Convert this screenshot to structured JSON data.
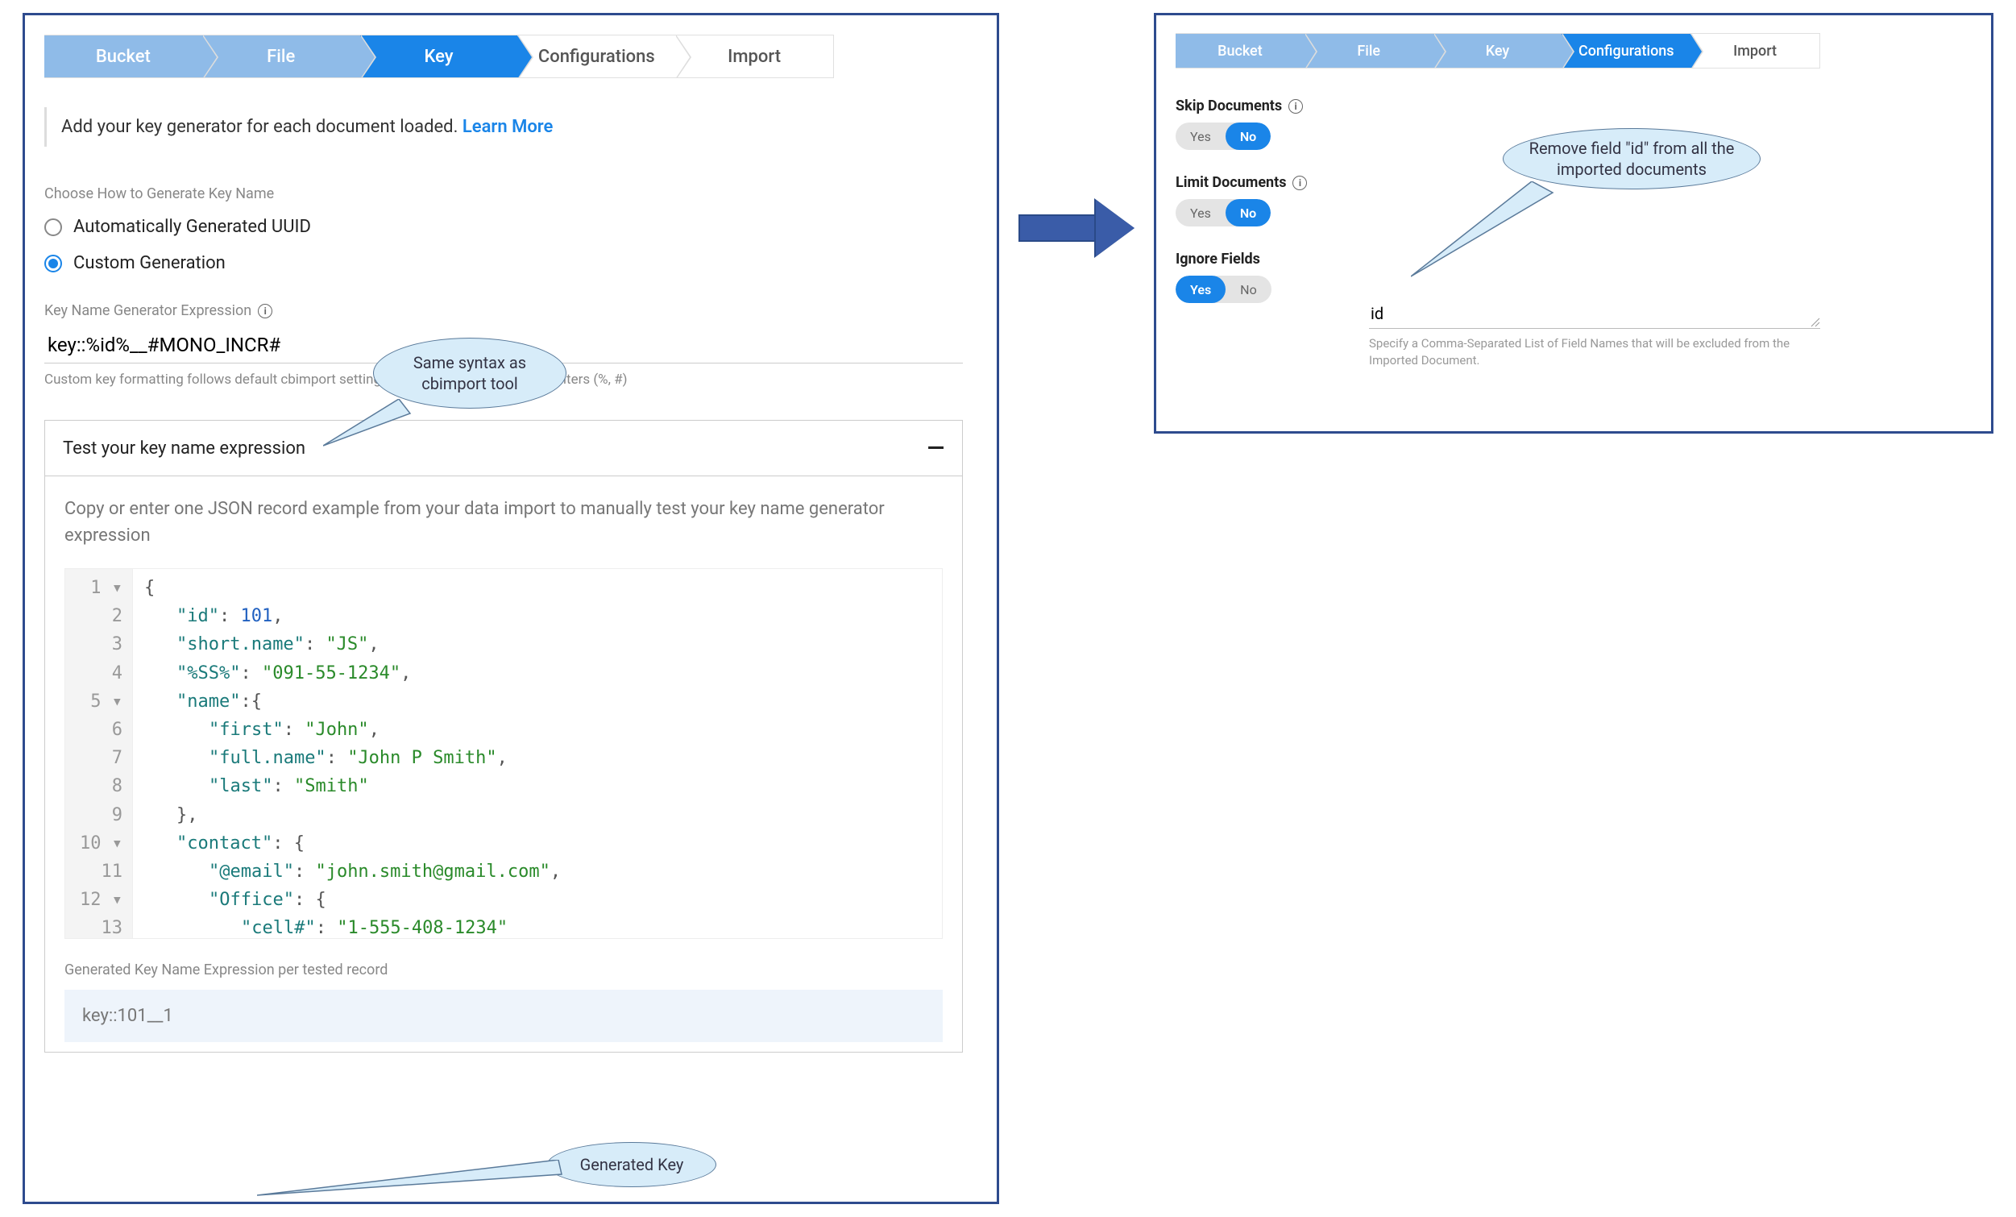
{
  "left": {
    "steps": [
      "Bucket",
      "File",
      "Key",
      "Configurations",
      "Import"
    ],
    "active_step_index": 2,
    "intro_text": "Add your key generator for each document loaded.",
    "intro_link": "Learn More",
    "choose_label": "Choose How to Generate Key Name",
    "radio_uuid": "Automatically Generated UUID",
    "radio_custom": "Custom Generation",
    "expr_label": "Key Name Generator Expression",
    "expr_value": "key::%id%__#MONO_INCR#",
    "expr_hint": "Custom key formatting follows default cbimport settings for field and generator delimiters (%, #)",
    "test_header": "Test your key name expression",
    "test_desc": "Copy or enter one JSON record example from your data import to manually test your key name generator expression",
    "code_gutter": [
      "1 ▾",
      "2",
      "3",
      "4",
      "5 ▾",
      "6",
      "7",
      "8",
      "9",
      "10 ▾",
      "11",
      "12 ▾",
      "13"
    ],
    "code_lines": [
      {
        "indent": 0,
        "tokens": [
          {
            "t": "punc",
            "v": "{"
          }
        ]
      },
      {
        "indent": 1,
        "tokens": [
          {
            "t": "key",
            "v": "\"id\""
          },
          {
            "t": "punc",
            "v": ": "
          },
          {
            "t": "num",
            "v": "101"
          },
          {
            "t": "punc",
            "v": ","
          }
        ]
      },
      {
        "indent": 1,
        "tokens": [
          {
            "t": "key",
            "v": "\"short.name\""
          },
          {
            "t": "punc",
            "v": ": "
          },
          {
            "t": "str",
            "v": "\"JS\""
          },
          {
            "t": "punc",
            "v": ","
          }
        ]
      },
      {
        "indent": 1,
        "tokens": [
          {
            "t": "key",
            "v": "\"%SS%\""
          },
          {
            "t": "punc",
            "v": ": "
          },
          {
            "t": "str",
            "v": "\"091-55-1234\""
          },
          {
            "t": "punc",
            "v": ","
          }
        ]
      },
      {
        "indent": 1,
        "tokens": [
          {
            "t": "key",
            "v": "\"name\""
          },
          {
            "t": "punc",
            "v": ":{"
          }
        ]
      },
      {
        "indent": 2,
        "tokens": [
          {
            "t": "key",
            "v": "\"first\""
          },
          {
            "t": "punc",
            "v": ": "
          },
          {
            "t": "str",
            "v": "\"John\""
          },
          {
            "t": "punc",
            "v": ","
          }
        ]
      },
      {
        "indent": 2,
        "tokens": [
          {
            "t": "key",
            "v": "\"full.name\""
          },
          {
            "t": "punc",
            "v": ": "
          },
          {
            "t": "str",
            "v": "\"John P Smith\""
          },
          {
            "t": "punc",
            "v": ","
          }
        ]
      },
      {
        "indent": 2,
        "tokens": [
          {
            "t": "key",
            "v": "\"last\""
          },
          {
            "t": "punc",
            "v": ": "
          },
          {
            "t": "str",
            "v": "\"Smith\""
          }
        ]
      },
      {
        "indent": 1,
        "tokens": [
          {
            "t": "punc",
            "v": "},"
          }
        ]
      },
      {
        "indent": 1,
        "tokens": [
          {
            "t": "key",
            "v": "\"contact\""
          },
          {
            "t": "punc",
            "v": ": {"
          }
        ]
      },
      {
        "indent": 2,
        "tokens": [
          {
            "t": "key",
            "v": "\"@email\""
          },
          {
            "t": "punc",
            "v": ": "
          },
          {
            "t": "str",
            "v": "\"john.smith@gmail.com\""
          },
          {
            "t": "punc",
            "v": ","
          }
        ]
      },
      {
        "indent": 2,
        "tokens": [
          {
            "t": "key",
            "v": "\"Office\""
          },
          {
            "t": "punc",
            "v": ": {"
          }
        ]
      },
      {
        "indent": 3,
        "tokens": [
          {
            "t": "key",
            "v": "\"cell#\""
          },
          {
            "t": "punc",
            "v": ": "
          },
          {
            "t": "str",
            "v": "\"1-555-408-1234\""
          }
        ]
      }
    ],
    "gen_label": "Generated Key Name Expression per tested record",
    "gen_value": "key::101__1",
    "callout_syntax": "Same syntax as cbimport tool",
    "callout_genkey": "Generated Key"
  },
  "right": {
    "steps": [
      "Bucket",
      "File",
      "Key",
      "Configurations",
      "Import"
    ],
    "active_step_index": 3,
    "skip_label": "Skip Documents",
    "limit_label": "Limit Documents",
    "ignore_label": "Ignore Fields",
    "yes": "Yes",
    "no": "No",
    "skip_value": "No",
    "limit_value": "No",
    "ignore_value": "Yes",
    "ignore_field_value": "id",
    "ignore_hint": "Specify a Comma-Separated List of Field Names that will be excluded from the Imported Document.",
    "callout_remove": "Remove field \"id\" from all the imported documents"
  }
}
